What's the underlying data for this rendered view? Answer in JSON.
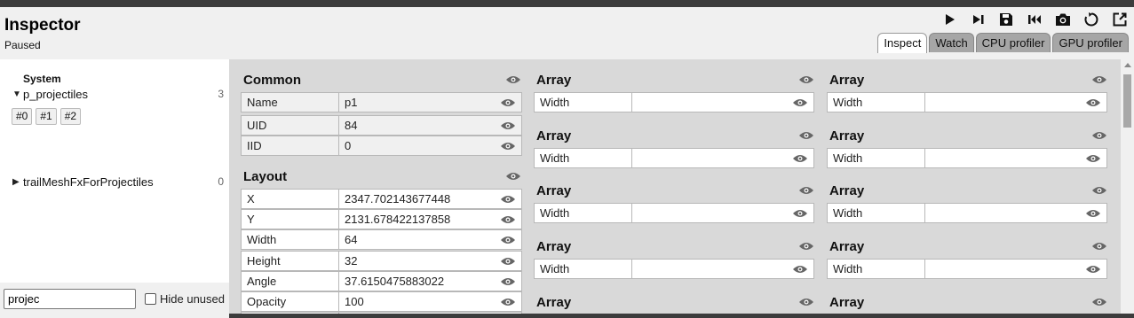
{
  "app": {
    "title": "Inspector",
    "status": "Paused"
  },
  "toolbar": {
    "buttons": [
      {
        "name": "play-icon"
      },
      {
        "name": "step-icon"
      },
      {
        "name": "save-icon"
      },
      {
        "name": "rewind-icon"
      },
      {
        "name": "camera-icon"
      },
      {
        "name": "reset-icon"
      },
      {
        "name": "popout-icon"
      }
    ]
  },
  "tabs": [
    "Inspect",
    "Watch",
    "CPU profiler",
    "GPU profiler"
  ],
  "active_tab": "Inspect",
  "sidebar": {
    "system_label": "System",
    "tree": [
      {
        "name": "p_projectiles",
        "count": "3",
        "expanded": true,
        "instances": [
          "#0",
          "#1",
          "#2"
        ]
      },
      {
        "name": "trailMeshFxForProjectiles",
        "count": "0",
        "expanded": false
      }
    ],
    "search": {
      "value": "projec"
    },
    "hide_unused_label": "Hide unused"
  },
  "common": {
    "title": "Common",
    "rows": [
      {
        "key": "Name",
        "value": "p1"
      },
      {
        "key": "UID",
        "value": "84"
      },
      {
        "key": "IID",
        "value": "0"
      }
    ]
  },
  "layout": {
    "title": "Layout",
    "rows": [
      {
        "key": "X",
        "value": "2347.702143677448"
      },
      {
        "key": "Y",
        "value": "2131.678422137858"
      },
      {
        "key": "Width",
        "value": "64"
      },
      {
        "key": "Height",
        "value": "32"
      },
      {
        "key": "Angle",
        "value": "37.6150475883022"
      },
      {
        "key": "Opacity",
        "value": "100"
      }
    ]
  },
  "arrays": {
    "title": "Array",
    "row_key": "Width",
    "row_value": ""
  }
}
